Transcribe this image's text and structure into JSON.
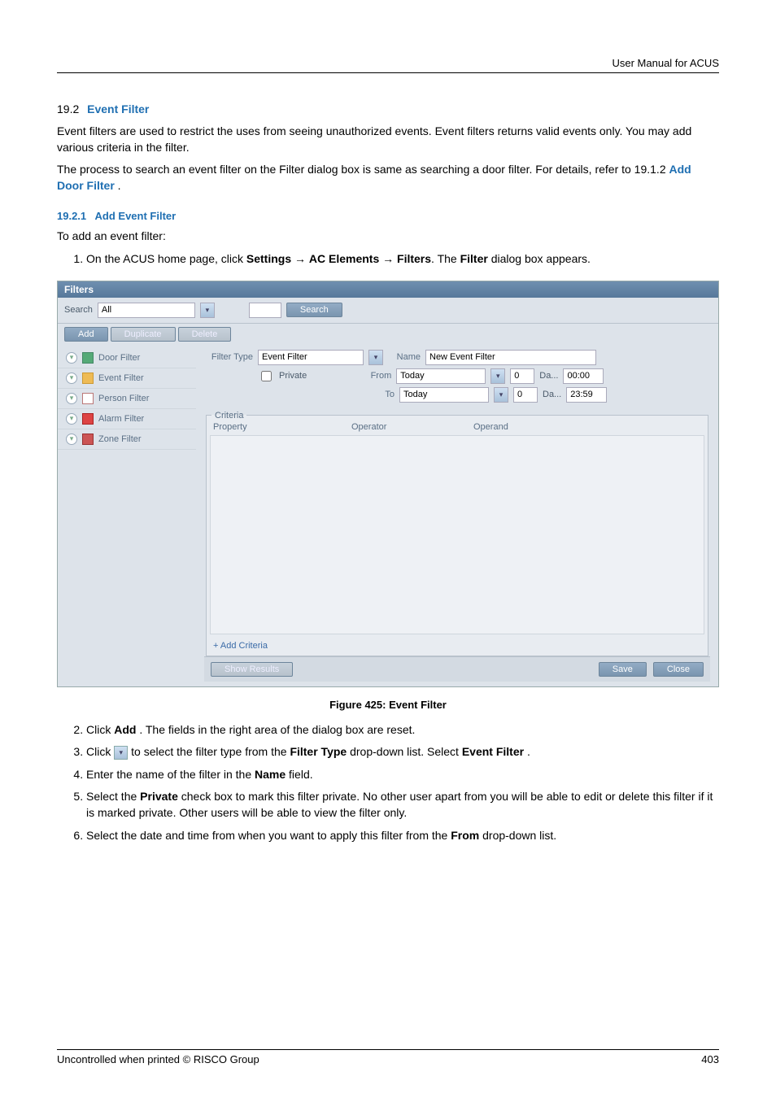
{
  "header": {
    "right": "User Manual for ACUS"
  },
  "section": {
    "num": "19.2",
    "title": "Event Filter",
    "p1": "Event filters are used to restrict the uses from seeing unauthorized events. Event filters returns valid events only. You may add various criteria in the filter.",
    "p2a": "The process to search an event filter on the Filter dialog box is same as searching a door filter. For details, refer to 19.1.2 ",
    "p2link": "Add Door Filter",
    "p2b": "."
  },
  "subsection": {
    "num": "19.2.1",
    "title": "Add Event Filter",
    "intro": "To add an event filter:"
  },
  "step1a": "On the ACUS home page, click ",
  "step1b": " dialog box appears.",
  "arrow": "→",
  "dialog": {
    "title": "Filters",
    "search_label": "Search",
    "search_value": "All",
    "btn_search": "Search",
    "btn_add": "Add",
    "btn_dup": "Duplicate",
    "btn_del": "Delete",
    "side": {
      "door": "Door Filter",
      "event": "Event Filter",
      "person": "Person Filter",
      "alarm": "Alarm Filter",
      "zone": "Zone Filter"
    },
    "form": {
      "filtertype_label": "Filter Type",
      "filtertype_value": "Event Filter",
      "name_label": "Name",
      "name_value": "New Event Filter",
      "private_label": "Private",
      "from_label": "From",
      "from_value": "Today",
      "from_days": "0",
      "from_days_lbl": "Da...",
      "from_time": "00:00",
      "to_label": "To",
      "to_value": "Today",
      "to_days": "0",
      "to_days_lbl": "Da...",
      "to_time": "23:59"
    },
    "criteria": {
      "legend": "Criteria",
      "property": "Property",
      "operator": "Operator",
      "operand": "Operand",
      "add": "+ Add Criteria"
    },
    "bottom": {
      "show": "Show Results",
      "save": "Save",
      "close": "Close"
    }
  },
  "figure_caption": "Figure 425: Event Filter",
  "steps_after": {
    "s2a": "Click ",
    "s2b": ". The fields in the right area of the dialog box are reset.",
    "s3a": "Click ",
    "s3b": " to select the filter type from the ",
    "s3c": " drop-down list. Select ",
    "s3d": ".",
    "s4a": "Enter the name of the filter in the ",
    "s4b": " field.",
    "s5a": "Select the ",
    "s5b": " check box to mark this filter private. No other user apart from you will be able to edit or delete this filter if it is marked private. Other users will be able to view the filter only.",
    "s6a": "Select the date and time from when you want to apply this filter from the ",
    "s6b": " drop-down list."
  },
  "bold": {
    "settings": "Settings",
    "ac_elements": "AC Elements",
    "filters": "Filters",
    "filter": "Filter",
    "add": "Add",
    "filter_type": "Filter Type",
    "event_filter": "Event Filter",
    "name": "Name",
    "private": "Private",
    "from": "From"
  },
  "footer": {
    "left": "Uncontrolled when printed © RISCO Group",
    "right": "403"
  }
}
